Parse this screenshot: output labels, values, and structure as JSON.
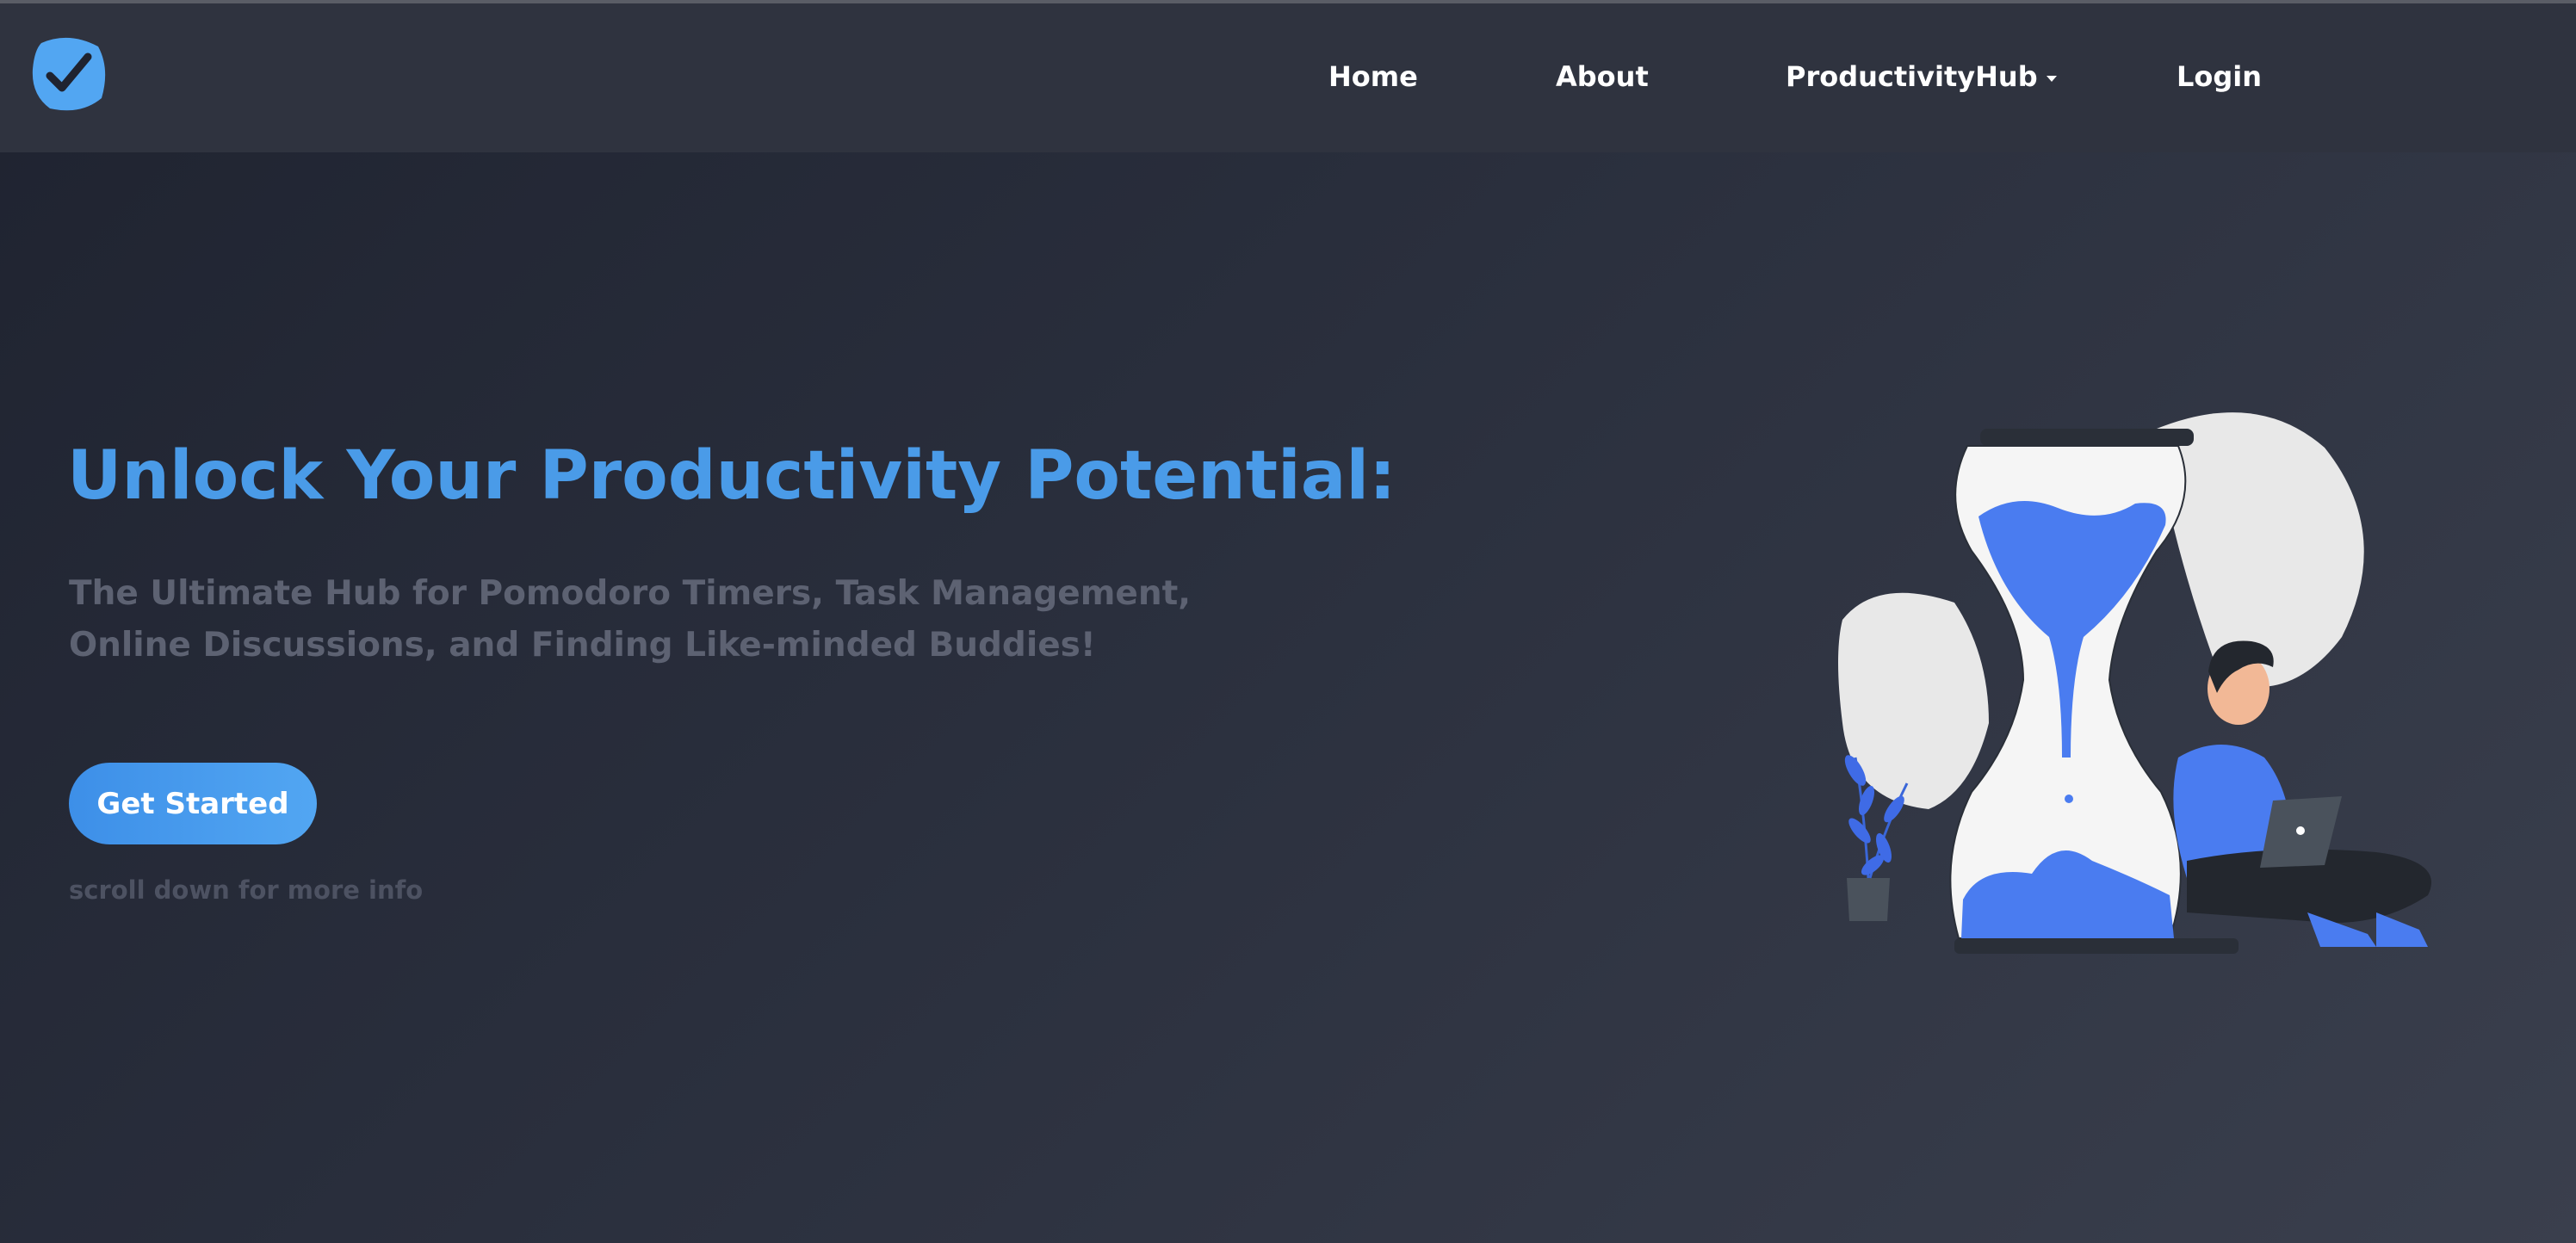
{
  "colors": {
    "accent": "#4a9be8",
    "button_start": "#3d8fe8",
    "button_end": "#52a6f2",
    "navbar_bg": "#2f333f",
    "illustration_blue": "#4a7cf0"
  },
  "header": {
    "logo_icon": "checkmark-icon",
    "nav": {
      "home": "Home",
      "about": "About",
      "productivity_hub": "ProductivityHub",
      "login": "Login"
    }
  },
  "hero": {
    "title": "Unlock Your Productivity Potential:",
    "subtitle_line1": "The Ultimate Hub for Pomodoro Timers, Task Management,",
    "subtitle_line2": "Online Discussions, and Finding Like-minded Buddies!",
    "cta_label": "Get Started",
    "scroll_hint": "scroll down for more info"
  },
  "illustration": {
    "icon": "hourglass-person-laptop-illustration"
  }
}
